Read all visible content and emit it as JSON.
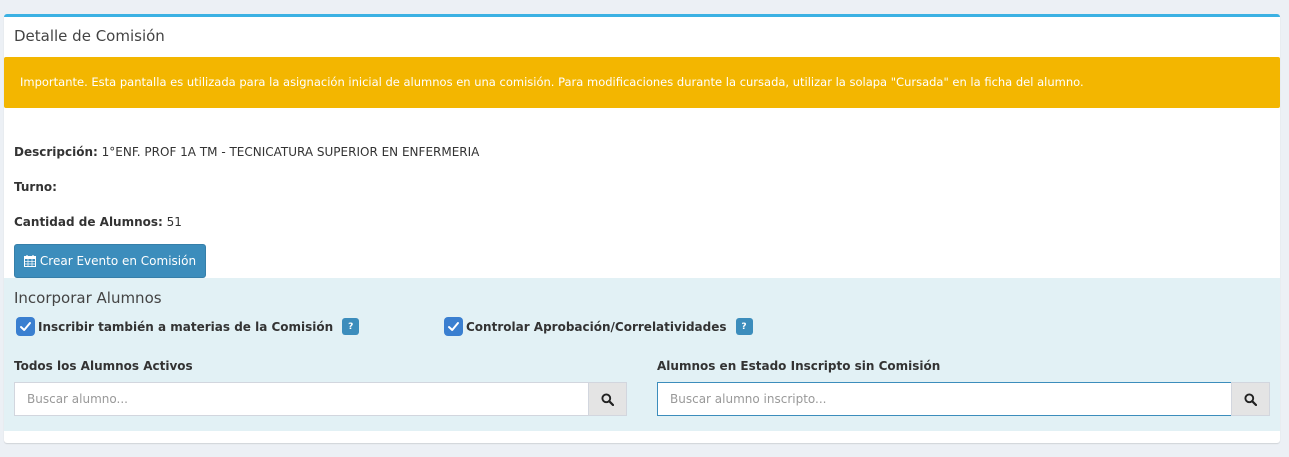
{
  "box": {
    "title": "Detalle de Comisión"
  },
  "alert": {
    "text": "Importante. Esta pantalla es utilizada para la asignación inicial de alumnos en una comisión. Para modificaciones durante la cursada, utilizar la solapa \"Cursada\" en la ficha del alumno."
  },
  "details": {
    "descripcion_label": "Descripción:",
    "descripcion_value": "1°ENF. PROF 1A TM - TECNICATURA SUPERIOR EN ENFERMERIA",
    "turno_label": "Turno:",
    "turno_value": "",
    "cantidad_label": "Cantidad de Alumnos:",
    "cantidad_value": "51"
  },
  "actions": {
    "crear_evento_label": "Crear Evento en Comisión"
  },
  "incorporar": {
    "title": "Incorporar Alumnos",
    "check_materias_label": "Inscribir también a materias de la Comisión",
    "check_materias_checked": true,
    "check_aprobacion_label": "Controlar Aprobación/Correlatividades",
    "check_aprobacion_checked": true,
    "help_glyph": "?",
    "activos_label": "Todos los Alumnos Activos",
    "activos_placeholder": "Buscar alumno...",
    "inscriptos_label": "Alumnos en Estado Inscripto sin Comisión",
    "inscriptos_placeholder": "Buscar alumno inscripto..."
  },
  "icons": {
    "calendar": "calendar-icon",
    "search": "search-icon",
    "check": "check-icon",
    "help": "help-icon"
  },
  "colors": {
    "primary": "#3c8dbc",
    "warning": "#f3b600",
    "box_border": "#3bb1e3",
    "section_bg": "#e2f1f5"
  }
}
